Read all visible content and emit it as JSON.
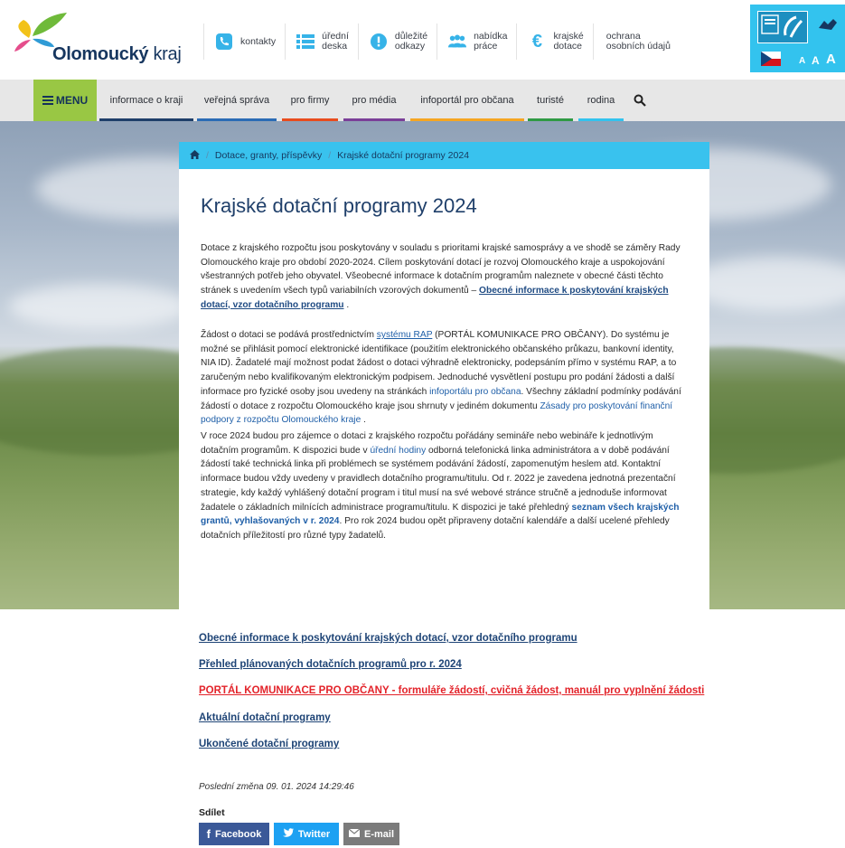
{
  "header": {
    "logo": {
      "bold": "Olomoucký",
      "rest": " kraj"
    },
    "quick_links": [
      {
        "label": "kontakty",
        "icon": "phone-icon"
      },
      {
        "label": "úřední\ndeska",
        "icon": "list-icon"
      },
      {
        "label": "důležité\nodkazy",
        "icon": "exclamation-icon"
      },
      {
        "label": "nabídka\npráce",
        "icon": "people-icon"
      },
      {
        "label": "krajské\ndotace",
        "icon": "euro-icon"
      },
      {
        "label": "ochrana\nosobních údajů",
        "icon": ""
      }
    ],
    "accessibility": {
      "font_sizes": [
        "A",
        "A",
        "A"
      ]
    }
  },
  "nav": {
    "menu_label": "MENU",
    "items": [
      {
        "label": "informace o kraji",
        "color": "#1f3f6a"
      },
      {
        "label": "veřejná správa",
        "color": "#2b6cb5"
      },
      {
        "label": "pro firmy",
        "color": "#e84c1e"
      },
      {
        "label": "pro média",
        "color": "#7b3f98"
      },
      {
        "label": "infoportál pro občana",
        "color": "#f5a623"
      },
      {
        "label": "turisté",
        "color": "#2f9a44"
      },
      {
        "label": "rodina",
        "color": "#33c3ee"
      }
    ]
  },
  "breadcrumb": {
    "items": [
      "Dotace, granty, příspěvky",
      "Krajské dotační programy 2024"
    ]
  },
  "page": {
    "title": "Krajské dotační programy 2024",
    "p1": "Dotace z krajského rozpočtu jsou poskytovány v souladu s prioritami krajské samosprávy a ve shodě se záměry Rady Olomouckého kraje pro období 2020-2024. Cílem poskytování dotací je rozvoj Olomouckého kraje a uspokojování všestranných potřeb jeho obyvatel. Všeobecné informace k dotačním programům naleznete v obecné části těchto stránek s uvedením všech typů variabilních vzorových dokumentů – ",
    "p1_link": "Obecné informace k poskytování krajských dotací, vzor dotačního programu",
    "p1_end": " .",
    "p2_a": "Žádost o dotaci se podává prostřednictvím ",
    "p2_link1": "systému RAP",
    "p2_b": " (PORTÁL KOMUNIKACE PRO OBČANY). Do systému je možné se přihlásit pomocí elektronické identifikace (použitím elektronického občanského průkazu, bankovní identity, NIA ID). Žadatelé mají možnost podat žádost o dotaci výhradně elektronicky, podepsáním přímo v systému RAP, a to zaručeným nebo kvalifikovaným elektronickým podpisem. Jednoduché vysvětlení postupu pro podání žádosti a další informace pro fyzické osoby jsou uvedeny na stránkách ",
    "p2_link2": "infoportálu pro občana",
    "p2_c": ". Všechny základní podmínky podávání žádostí o dotace z rozpočtu Olomouckého kraje jsou shrnuty v jediném dokumentu ",
    "p2_link3": "Zásady pro poskytování finanční podpory z rozpočtu Olomouckého kraje",
    "p2_d": " .",
    "p3_a": "V roce 2024 budou pro zájemce o dotaci z krajského rozpočtu pořádány semináře nebo webináře k jednotlivým dotačním programům. K dispozici bude v ",
    "p3_link1": "úřední hodiny",
    "p3_b": " odborná telefonická linka administrátora a v době podávání žádostí také technická linka při problémech se systémem podávání žádostí, zapomenutým heslem atd. Kontaktní informace budou vždy uvedeny v pravidlech dotačního programu/titulu. Od r. 2022 je zavedena jednotná prezentační strategie, kdy každý vyhlášený dotační program i titul musí na své webové stránce stručně a jednoduše informovat žadatele o základních milnících administrace programu/titulu. K dispozici je také přehledný ",
    "p3_link2": "seznam všech krajských grantů, vyhlašovaných v r. 2024",
    "p3_c": ". Pro rok 2024 budou opět připraveny dotační kalendáře a další ucelené přehledy dotačních příležitostí pro různé typy žadatelů."
  },
  "links": [
    {
      "label": "Obecné informace k poskytování krajských dotací, vzor dotačního programu",
      "color": "#1e4476"
    },
    {
      "label": "Přehled plánovaných dotačních programů pro r. 2024",
      "color": "#1e4476"
    },
    {
      "label": "PORTÁL KOMUNIKACE PRO OBČANY - formuláře žádostí, cvičná žádost, manuál pro vyplnění žádosti",
      "color": "#e3232a"
    },
    {
      "label": "Aktuální dotační programy",
      "color": "#1e4476"
    },
    {
      "label": "Ukončené dotační programy",
      "color": "#1e4476"
    }
  ],
  "footer": {
    "last_change": "Poslední změna 09. 01. 2024 14:29:46",
    "share_title": "Sdílet",
    "share_buttons": [
      {
        "label": "Facebook",
        "icon": "facebook-icon",
        "color": "#3b5998"
      },
      {
        "label": "Twitter",
        "icon": "twitter-icon",
        "color": "#1da1f2"
      },
      {
        "label": "E-mail",
        "icon": "mail-icon",
        "color": "#7b7b7b"
      }
    ]
  }
}
